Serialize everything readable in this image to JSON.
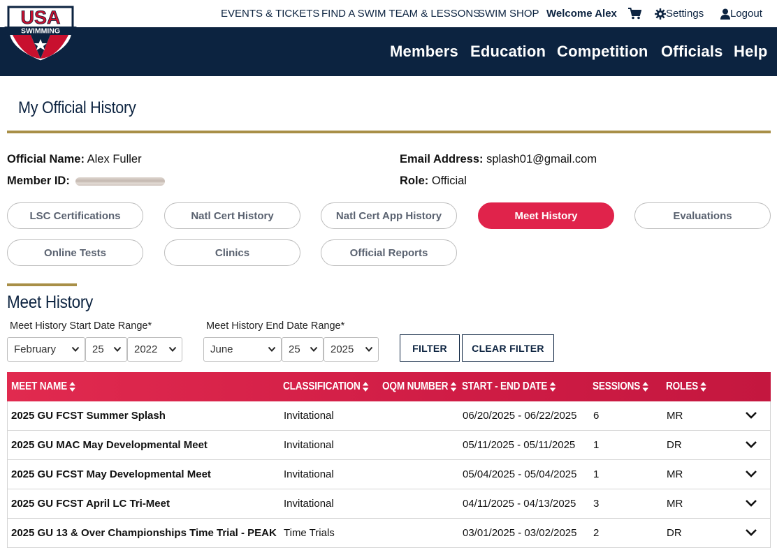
{
  "logo": {
    "line1": "USA",
    "line2": "SWIMMING"
  },
  "utility_nav": {
    "events": "EVENTS & TICKETS",
    "find_team": "FIND A SWIM TEAM & LESSONS",
    "shop": "SWIM SHOP",
    "welcome": "Welcome Alex",
    "cart_icon": "cart-icon",
    "settings": "Settings",
    "logout": "Logout"
  },
  "main_nav": [
    "Members",
    "Education",
    "Competition",
    "Officials",
    "Help"
  ],
  "page_title": "My Official History",
  "profile": {
    "name_label": "Official Name:",
    "name_value": "Alex Fuller",
    "member_label": "Member ID:",
    "email_label": "Email Address:",
    "email_value": "splash01@gmail.com",
    "role_label": "Role:",
    "role_value": "Official"
  },
  "tabs": [
    {
      "label": "LSC Certifications",
      "active": false
    },
    {
      "label": "Natl Cert History",
      "active": false
    },
    {
      "label": "Natl Cert App History",
      "active": false
    },
    {
      "label": "Meet History",
      "active": true
    },
    {
      "label": "Evaluations",
      "active": false
    },
    {
      "label": "Online Tests",
      "active": false
    },
    {
      "label": "Clinics",
      "active": false
    },
    {
      "label": "Official Reports",
      "active": false
    }
  ],
  "section_title": "Meet History",
  "filter": {
    "start_label": "Meet History Start Date Range*",
    "end_label": "Meet History End Date Range*",
    "start_month": "February",
    "start_day": "25",
    "start_year": "2022",
    "end_month": "June",
    "end_day": "25",
    "end_year": "2025",
    "filter_button": "FILTER",
    "clear_button": "CLEAR FILTER"
  },
  "table": {
    "columns": [
      "MEET NAME",
      "CLASSIFICATION",
      "OQM NUMBER",
      "START - END DATE",
      "SESSIONS",
      "ROLES"
    ],
    "rows": [
      {
        "name": "2025 GU FCST Summer Splash",
        "classification": "Invitational",
        "oqm": "",
        "dates": "06/20/2025 - 06/22/2025",
        "sessions": "6",
        "roles": "MR"
      },
      {
        "name": "2025 GU MAC May Developmental Meet",
        "classification": "Invitational",
        "oqm": "",
        "dates": "05/11/2025 - 05/11/2025",
        "sessions": "1",
        "roles": "DR"
      },
      {
        "name": "2025 GU FCST May Developmental Meet",
        "classification": "Invitational",
        "oqm": "",
        "dates": "05/04/2025 - 05/04/2025",
        "sessions": "1",
        "roles": "MR"
      },
      {
        "name": "2025 GU FCST April LC Tri-Meet",
        "classification": "Invitational",
        "oqm": "",
        "dates": "04/11/2025 - 04/13/2025",
        "sessions": "3",
        "roles": "MR"
      },
      {
        "name": "2025 GU 13 & Over Championships Time Trial - PEAK",
        "classification": "Time Trials",
        "oqm": "",
        "dates": "03/01/2025 - 03/02/2025",
        "sessions": "2",
        "roles": "DR"
      }
    ]
  },
  "colors": {
    "navy": "#0c2340",
    "accent_red": "#e0234b",
    "gold": "#a88f47"
  }
}
